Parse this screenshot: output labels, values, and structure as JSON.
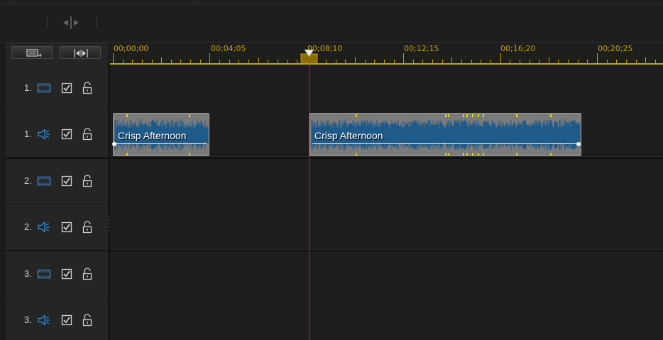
{
  "toolbar": {
    "split_icon": "split-clip-icon"
  },
  "header_buttons": [
    {
      "icon": "track-manager-icon"
    },
    {
      "icon": "fit-timeline-icon"
    }
  ],
  "ruler": {
    "labels": [
      "00;00;00",
      "00;04;05",
      "00;08;10",
      "00;12;15",
      "00;16;20",
      "00;20;25"
    ],
    "color": "#c6a000"
  },
  "playhead": {
    "color": "#d0201a",
    "timecode": "00;08;10"
  },
  "tracks": [
    {
      "number": "1.",
      "type": "video",
      "icon": "video-track-icon",
      "enabled": true,
      "locked": false
    },
    {
      "number": "1.",
      "type": "audio",
      "icon": "speaker-icon",
      "enabled": true,
      "locked": false
    },
    {
      "number": "2.",
      "type": "video",
      "icon": "video-track-icon",
      "enabled": true,
      "locked": false
    },
    {
      "number": "2.",
      "type": "audio",
      "icon": "speaker-icon",
      "enabled": true,
      "locked": false
    },
    {
      "number": "3.",
      "type": "video",
      "icon": "video-track-icon",
      "enabled": true,
      "locked": false
    },
    {
      "number": "3.",
      "type": "audio",
      "icon": "speaker-icon",
      "enabled": true,
      "locked": false
    }
  ],
  "clips": [
    {
      "title": "Crisp Afternoon",
      "track": "1. audio"
    },
    {
      "title": "Crisp Afternoon",
      "track": "1. audio"
    }
  ],
  "colors": {
    "accent_blue": "#3a8fd8",
    "wave_blue": "#1f5b8a",
    "peak_yellow": "#e8e000"
  }
}
